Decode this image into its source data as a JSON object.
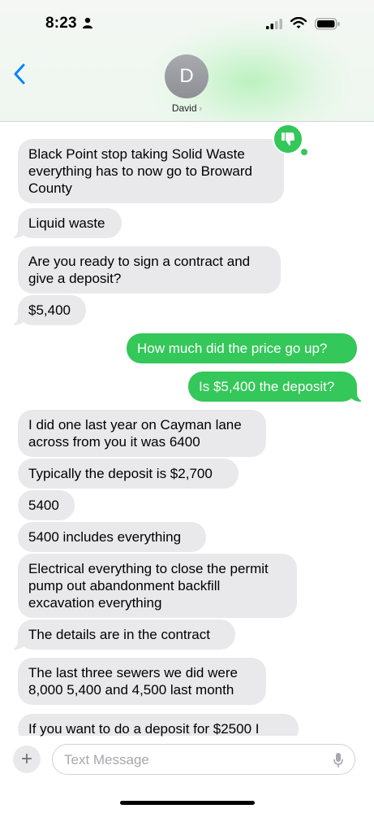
{
  "status_bar": {
    "time": "8:23"
  },
  "header": {
    "avatar_initial": "D",
    "contact_name": "David",
    "chevron": "›"
  },
  "messages": [
    {
      "side": "in",
      "text": "Black Point stop taking Solid Waste everything has to now go to Broward County"
    },
    {
      "side": "in",
      "text": "Liquid waste"
    },
    {
      "side": "in",
      "text": "Are you ready to sign a contract and give a deposit?"
    },
    {
      "side": "in",
      "text": "$5,400"
    },
    {
      "side": "out",
      "text": "How much did the price go up?"
    },
    {
      "side": "out",
      "text": "Is $5,400 the deposit?"
    },
    {
      "side": "in",
      "text": "I did one last year on Cayman lane across from you it was 6400"
    },
    {
      "side": "in",
      "text": "Typically the deposit is $2,700"
    },
    {
      "side": "in",
      "text": "5400"
    },
    {
      "side": "in",
      "text": "5400 includes everything"
    },
    {
      "side": "in",
      "text": "Electrical everything to close the permit pump out abandonment backfill excavation everything"
    },
    {
      "side": "in",
      "text": "The details are in the contract"
    },
    {
      "side": "in",
      "text": "The last three sewers we did were 8,000 5,400 and 4,500 last month"
    },
    {
      "side": "in",
      "text": "If you want to do a deposit for $2500 I"
    }
  ],
  "reaction": {
    "icon": "thumbs-down-icon",
    "color": "#34c759"
  },
  "composer": {
    "placeholder": "Text Message",
    "plus": "+"
  },
  "colors": {
    "incoming": "#e9e9eb",
    "outgoing": "#34c759",
    "accent": "#0a84ff"
  }
}
